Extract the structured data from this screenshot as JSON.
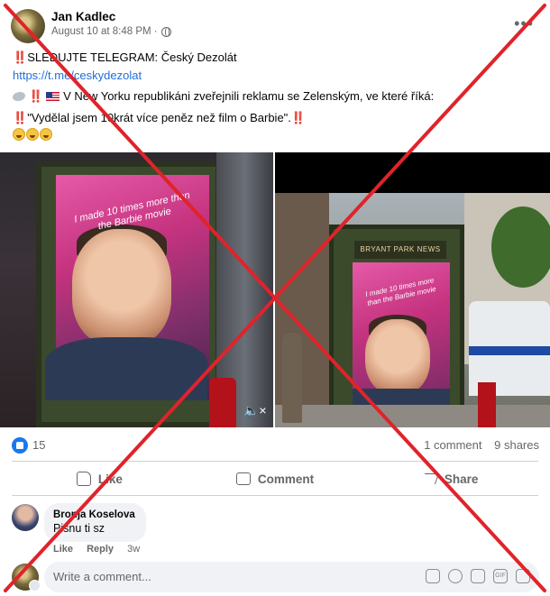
{
  "post": {
    "author": "Jan Kadlec",
    "timestamp": "August 10 at 8:48 PM ·",
    "line1": "SLEDUJTE TELEGRAM: Český Dezolát",
    "link": "https://t.me/ceskydezolat",
    "line3": "V New Yorku republikáni zveřejnili reklamu se Zelenským, ve které říká:",
    "quote": "\"Vydělal jsem 10krát více peněz než film o Barbie\".",
    "bang": "‼️"
  },
  "media": {
    "left_ad_text": "I made 10 times more than the Barbie movie",
    "right_sign": "BRYANT PARK NEWS",
    "right_ad_text": "I made 10 times more than the Barbie movie"
  },
  "stats": {
    "reactions": "15",
    "comments": "1 comment",
    "shares": "9 shares"
  },
  "actions": {
    "like": "Like",
    "comment": "Comment",
    "share": "Share"
  },
  "comment": {
    "name": "Bronja Koselova",
    "text": "Pisnu ti sz",
    "like": "Like",
    "reply": "Reply",
    "age": "3w"
  },
  "writer": {
    "placeholder": "Write a comment..."
  },
  "colors": {
    "link": "#216fdb",
    "facebook_blue": "#1877f2",
    "overlay_cross": "#e0232a"
  }
}
